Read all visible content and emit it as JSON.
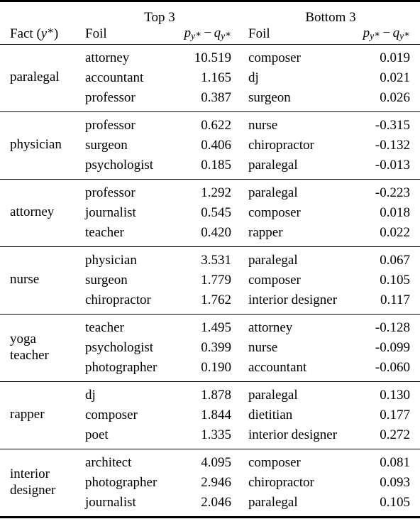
{
  "table": {
    "group_headers": {
      "top": "Top 3",
      "bottom": "Bottom 3"
    },
    "columns": {
      "fact": "Fact (y*)",
      "fact_plain": "Fact",
      "foil_left": "Foil",
      "value_left": "p_y* - q_y*",
      "foil_right": "Foil",
      "value_right": "p_y* - q_y*"
    },
    "blocks": [
      {
        "fact": "paralegal",
        "fact_lines": [
          "paralegal"
        ],
        "rows": [
          {
            "top_foil": "attorney",
            "top_value": "10.519",
            "bottom_foil": "composer",
            "bottom_value": "0.019"
          },
          {
            "top_foil": "accountant",
            "top_value": "1.165",
            "bottom_foil": "dj",
            "bottom_value": "0.021"
          },
          {
            "top_foil": "professor",
            "top_value": "0.387",
            "bottom_foil": "surgeon",
            "bottom_value": "0.026"
          }
        ]
      },
      {
        "fact": "physician",
        "fact_lines": [
          "physician"
        ],
        "rows": [
          {
            "top_foil": "professor",
            "top_value": "0.622",
            "bottom_foil": "nurse",
            "bottom_value": "-0.315"
          },
          {
            "top_foil": "surgeon",
            "top_value": "0.406",
            "bottom_foil": "chiropractor",
            "bottom_value": "-0.132"
          },
          {
            "top_foil": "psychologist",
            "top_value": "0.185",
            "bottom_foil": "paralegal",
            "bottom_value": "-0.013"
          }
        ]
      },
      {
        "fact": "attorney",
        "fact_lines": [
          "attorney"
        ],
        "rows": [
          {
            "top_foil": "professor",
            "top_value": "1.292",
            "bottom_foil": "paralegal",
            "bottom_value": "-0.223"
          },
          {
            "top_foil": "journalist",
            "top_value": "0.545",
            "bottom_foil": "composer",
            "bottom_value": "0.018"
          },
          {
            "top_foil": "teacher",
            "top_value": "0.420",
            "bottom_foil": "rapper",
            "bottom_value": "0.022"
          }
        ]
      },
      {
        "fact": "nurse",
        "fact_lines": [
          "nurse"
        ],
        "rows": [
          {
            "top_foil": "physician",
            "top_value": "3.531",
            "bottom_foil": "paralegal",
            "bottom_value": "0.067"
          },
          {
            "top_foil": "surgeon",
            "top_value": "1.779",
            "bottom_foil": "composer",
            "bottom_value": "0.105"
          },
          {
            "top_foil": "chiropractor",
            "top_value": "1.762",
            "bottom_foil": "interior designer",
            "bottom_value": "0.117"
          }
        ]
      },
      {
        "fact": "yoga teacher",
        "fact_lines": [
          "yoga",
          "teacher"
        ],
        "rows": [
          {
            "top_foil": "teacher",
            "top_value": "1.495",
            "bottom_foil": "attorney",
            "bottom_value": "-0.128"
          },
          {
            "top_foil": "psychologist",
            "top_value": "0.399",
            "bottom_foil": "nurse",
            "bottom_value": "-0.099"
          },
          {
            "top_foil": "photographer",
            "top_value": "0.190",
            "bottom_foil": "accountant",
            "bottom_value": "-0.060"
          }
        ]
      },
      {
        "fact": "rapper",
        "fact_lines": [
          "rapper"
        ],
        "rows": [
          {
            "top_foil": "dj",
            "top_value": "1.878",
            "bottom_foil": "paralegal",
            "bottom_value": "0.130"
          },
          {
            "top_foil": "composer",
            "top_value": "1.844",
            "bottom_foil": "dietitian",
            "bottom_value": "0.177"
          },
          {
            "top_foil": "poet",
            "top_value": "1.335",
            "bottom_foil": "interior designer",
            "bottom_value": "0.272"
          }
        ]
      },
      {
        "fact": "interior designer",
        "fact_lines": [
          "interior",
          "designer"
        ],
        "rows": [
          {
            "top_foil": "architect",
            "top_value": "4.095",
            "bottom_foil": "composer",
            "bottom_value": "0.081"
          },
          {
            "top_foil": "photographer",
            "top_value": "2.946",
            "bottom_foil": "chiropractor",
            "bottom_value": "0.093"
          },
          {
            "top_foil": "journalist",
            "top_value": "2.046",
            "bottom_foil": "paralegal",
            "bottom_value": "0.105"
          }
        ]
      }
    ]
  }
}
